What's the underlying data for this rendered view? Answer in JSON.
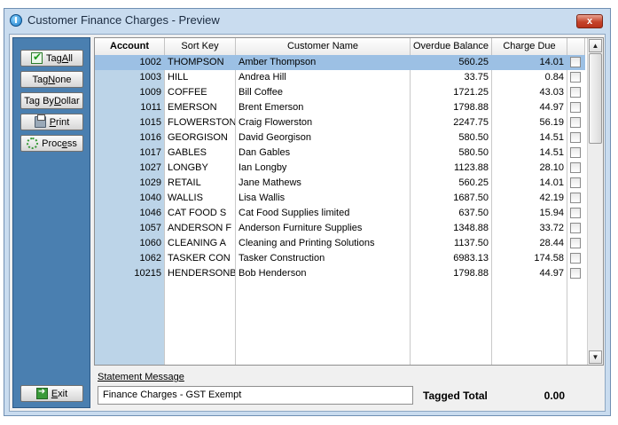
{
  "window": {
    "title": "Customer Finance Charges - Preview",
    "close_label": "x"
  },
  "sidebar": {
    "tag_all": {
      "pre": "Tag ",
      "key": "A",
      "post": "ll"
    },
    "tag_none": {
      "pre": "Tag ",
      "key": "N",
      "post": "one"
    },
    "tag_by_dollar": {
      "pre": "Tag By ",
      "key": "D",
      "post": "ollar"
    },
    "print": {
      "pre": "",
      "key": "P",
      "post": "rint"
    },
    "process": {
      "pre": "Proc",
      "key": "e",
      "post": "ss"
    },
    "exit": {
      "pre": "",
      "key": "E",
      "post": "xit"
    }
  },
  "grid": {
    "columns": [
      "Account",
      "Sort Key",
      "Customer Name",
      "Overdue Balance",
      "Charge Due"
    ],
    "rows": [
      {
        "account": "1002",
        "sort_key": "THOMPSON",
        "name": "Amber Thompson",
        "balance": "560.25",
        "charge": "14.01",
        "selected": true
      },
      {
        "account": "1003",
        "sort_key": "HILL",
        "name": "Andrea Hill",
        "balance": "33.75",
        "charge": "0.84"
      },
      {
        "account": "1009",
        "sort_key": "COFFEE",
        "name": "Bill Coffee",
        "balance": "1721.25",
        "charge": "43.03"
      },
      {
        "account": "1011",
        "sort_key": "EMERSON",
        "name": "Brent Emerson",
        "balance": "1798.88",
        "charge": "44.97"
      },
      {
        "account": "1015",
        "sort_key": "FLOWERSTON",
        "name": "Craig Flowerston",
        "balance": "2247.75",
        "charge": "56.19"
      },
      {
        "account": "1016",
        "sort_key": "GEORGISON",
        "name": "David Georgison",
        "balance": "580.50",
        "charge": "14.51"
      },
      {
        "account": "1017",
        "sort_key": "GABLES",
        "name": "Dan Gables",
        "balance": "580.50",
        "charge": "14.51"
      },
      {
        "account": "1027",
        "sort_key": "LONGBY",
        "name": "Ian Longby",
        "balance": "1123.88",
        "charge": "28.10"
      },
      {
        "account": "1029",
        "sort_key": "RETAIL",
        "name": "Jane Mathews",
        "balance": "560.25",
        "charge": "14.01"
      },
      {
        "account": "1040",
        "sort_key": "WALLIS",
        "name": "Lisa Wallis",
        "balance": "1687.50",
        "charge": "42.19"
      },
      {
        "account": "1046",
        "sort_key": "CAT FOOD S",
        "name": "Cat Food Supplies limited",
        "balance": "637.50",
        "charge": "15.94"
      },
      {
        "account": "1057",
        "sort_key": "ANDERSON F",
        "name": "Anderson Furniture Supplies",
        "balance": "1348.88",
        "charge": "33.72"
      },
      {
        "account": "1060",
        "sort_key": "CLEANING A",
        "name": "Cleaning and Printing Solutions",
        "balance": "1137.50",
        "charge": "28.44"
      },
      {
        "account": "1062",
        "sort_key": "TASKER CON",
        "name": "Tasker Construction",
        "balance": "6983.13",
        "charge": "174.58"
      },
      {
        "account": "10215",
        "sort_key": "HENDERSONB",
        "name": "Bob Henderson",
        "balance": "1798.88",
        "charge": "44.97"
      }
    ]
  },
  "statement": {
    "label": "Statement Message",
    "value": "Finance Charges - GST Exempt"
  },
  "tagged": {
    "label": "Tagged Total",
    "value": "0.00"
  },
  "colors": {
    "sidebar": "#4a7fb0",
    "selected_row": "#9cc0e4",
    "account_band": "#bcd4e8"
  }
}
